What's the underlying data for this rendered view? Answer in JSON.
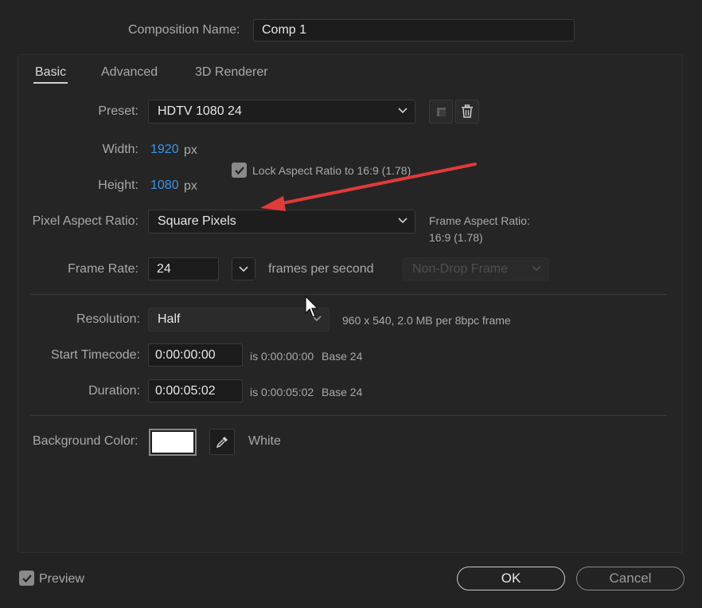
{
  "dialog": {
    "comp_name_label": "Composition Name:",
    "comp_name_value": "Comp 1"
  },
  "tabs": [
    {
      "label": "Basic",
      "active": true
    },
    {
      "label": "Advanced",
      "active": false
    },
    {
      "label": "3D Renderer",
      "active": false
    }
  ],
  "preset": {
    "label": "Preset:",
    "value": "HDTV 1080 24",
    "save_icon": "save-preset-icon",
    "delete_icon": "trash-icon"
  },
  "size": {
    "width_label": "Width:",
    "width_value": "1920",
    "height_label": "Height:",
    "height_value": "1080",
    "unit": "px",
    "lock_label": "Lock Aspect Ratio to 16:9 (1.78)",
    "lock_checked": true
  },
  "pixel_aspect": {
    "label": "Pixel Aspect Ratio:",
    "value": "Square Pixels",
    "frame_aspect_label": "Frame Aspect Ratio:",
    "frame_aspect_value": "16:9 (1.78)"
  },
  "frame_rate": {
    "label": "Frame Rate:",
    "value": "24",
    "unit_label": "frames per second",
    "drop_frame_value": "Non-Drop Frame"
  },
  "resolution": {
    "label": "Resolution:",
    "value": "Half",
    "info": "960 x 540, 2.0 MB per 8bpc frame"
  },
  "start_timecode": {
    "label": "Start Timecode:",
    "value": "0:00:00:00",
    "is_text": "is 0:00:00:00",
    "base_text": "Base 24"
  },
  "duration": {
    "label": "Duration:",
    "value": "0:00:05:02",
    "is_text": "is 0:00:05:02",
    "base_text": "Base 24"
  },
  "background": {
    "label": "Background Color:",
    "color": "#ffffff",
    "name": "White",
    "eyedropper_icon": "eyedropper-icon"
  },
  "footer": {
    "preview_label": "Preview",
    "preview_checked": true,
    "ok_label": "OK",
    "cancel_label": "Cancel"
  },
  "colors": {
    "accent_blue": "#3d93e6",
    "annotation_arrow": "#e03a3a"
  }
}
